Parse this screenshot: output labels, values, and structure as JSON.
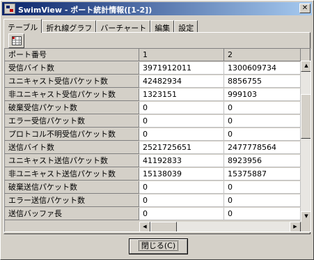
{
  "window": {
    "title": "SwimView - ポート統計情報([1-2])",
    "close_glyph": "✕"
  },
  "tabs": [
    {
      "label": "テーブル",
      "active": true
    },
    {
      "label": "折れ線グラフ",
      "active": false
    },
    {
      "label": "バーチャート",
      "active": false
    },
    {
      "label": "編集",
      "active": false
    },
    {
      "label": "設定",
      "active": false
    }
  ],
  "toolbar": {
    "table_icon": "table-grid-icon"
  },
  "table": {
    "header_label": "ポート番号",
    "columns": [
      "1",
      "2"
    ],
    "rows": [
      {
        "label": "受信バイト数",
        "values": [
          "3971912011",
          "1300609734"
        ]
      },
      {
        "label": "ユニキャスト受信パケット数",
        "values": [
          "42482934",
          "8856755"
        ]
      },
      {
        "label": "非ユニキャスト受信パケット数",
        "values": [
          "1323151",
          "999103"
        ]
      },
      {
        "label": "破棄受信パケット数",
        "values": [
          "0",
          "0"
        ]
      },
      {
        "label": "エラー受信パケット数",
        "values": [
          "0",
          "0"
        ]
      },
      {
        "label": "プロトコル不明受信パケット数",
        "values": [
          "0",
          "0"
        ]
      },
      {
        "label": "送信バイト数",
        "values": [
          "2521725651",
          "2477778564"
        ]
      },
      {
        "label": "ユニキャスト送信パケット数",
        "values": [
          "41192833",
          "8923956"
        ]
      },
      {
        "label": "非ユニキャスト送信パケット数",
        "values": [
          "15138039",
          "15375887"
        ]
      },
      {
        "label": "破棄送信パケット数",
        "values": [
          "0",
          "0"
        ]
      },
      {
        "label": "エラー送信パケット数",
        "values": [
          "0",
          "0"
        ]
      },
      {
        "label": "送信バッファ長",
        "values": [
          "0",
          "0"
        ]
      }
    ]
  },
  "scroll": {
    "up": "▲",
    "down": "▼",
    "left": "◀",
    "right": "▶"
  },
  "buttons": {
    "close_label": "閉じる(C)"
  }
}
